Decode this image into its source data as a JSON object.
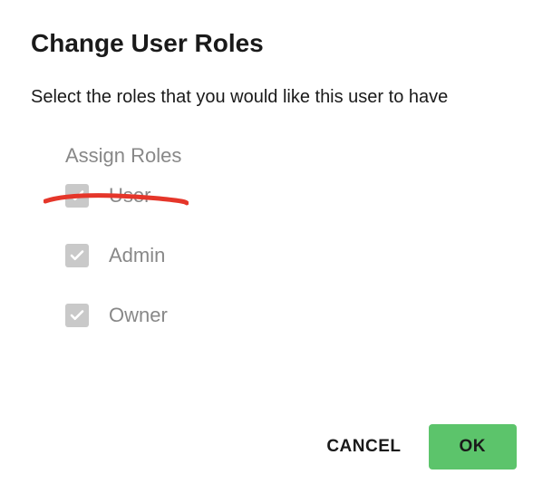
{
  "dialog": {
    "title": "Change User Roles",
    "subtitle": "Select the roles that you would like this user to have",
    "section_header": "Assign Roles",
    "roles": [
      {
        "label": "User",
        "checked": true
      },
      {
        "label": "Admin",
        "checked": true
      },
      {
        "label": "Owner",
        "checked": true
      }
    ],
    "buttons": {
      "cancel": "CANCEL",
      "ok": "OK"
    }
  },
  "annotation": {
    "type": "red-stroke",
    "description": "hand-drawn red line striking through the User role row"
  }
}
